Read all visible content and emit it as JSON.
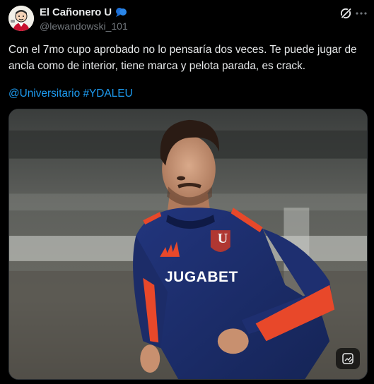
{
  "author": {
    "display_name": "El Cañonero U",
    "handle": "@lewandowski_101",
    "badge_icon": "speech-bubble-icon",
    "avatar_icon": "cartoon-avatar"
  },
  "header_actions": {
    "grok_icon": "grok-icon",
    "more_icon": "more-dots-icon"
  },
  "tweet": {
    "text": "Con el 7mo cupo aprobado no lo pensaría dos veces. Te puede jugar de ancla como de interior, tiene marca y pelota parada, es crack.",
    "mention": "@Universitario",
    "hashtag": "#YDALEU"
  },
  "media": {
    "sponsor_text": "JUGABET",
    "crest_letter": "U",
    "alt_icon": "alt-text-icon"
  },
  "colors": {
    "background": "#000000",
    "text": "#e7e9ea",
    "secondary": "#71767b",
    "link": "#1d9bf0",
    "jersey": "#1b2a6b",
    "jersey_accent": "#e8482a"
  }
}
